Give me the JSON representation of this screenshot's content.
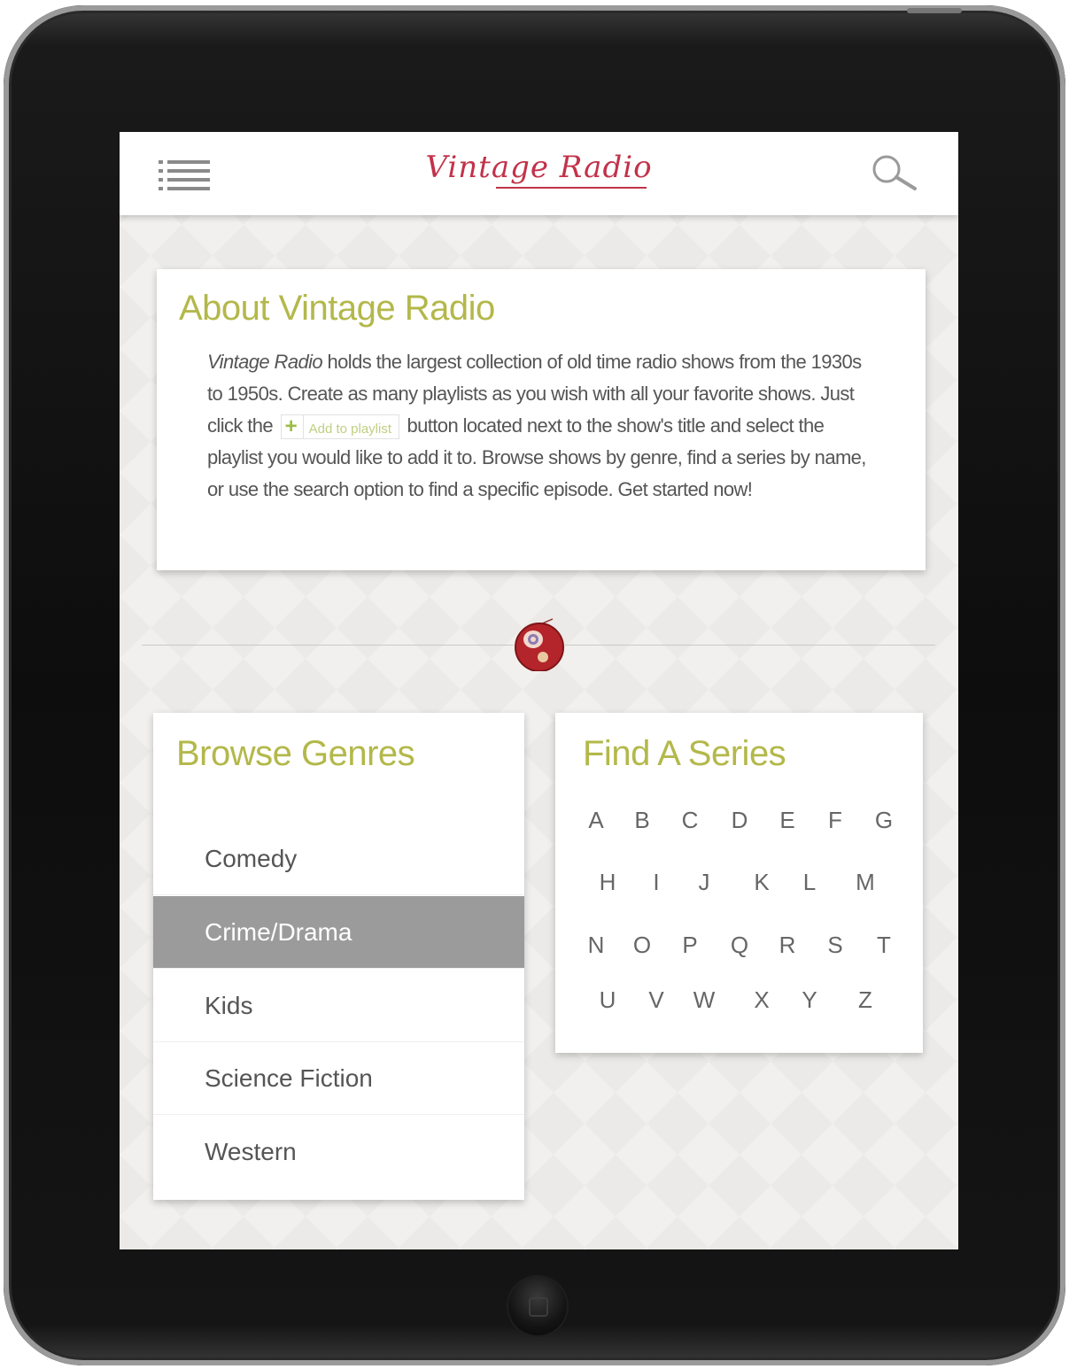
{
  "header": {
    "logo_text": "Vintage Radio",
    "menu_icon": "hamburger-menu-icon",
    "search_icon": "search-icon"
  },
  "about": {
    "title": "About Vintage Radio",
    "brand_italic": "Vintage Radio",
    "text_before_button": " holds the largest collection of old time radio shows from the 1930s to 1950s.  Create as many playlists as you wish with all your favorite shows.  Just click the ",
    "add_button_label": "Add to playlist",
    "text_after_button": " button located next to the show's title and select the playlist you would like to add it to.  Browse shows by genre, find a series by name, or use the search option to find a specific episode.  Get started now!"
  },
  "genres": {
    "title": "Browse Genres",
    "items": [
      "Comedy",
      "Crime/Drama",
      "Kids",
      "Science Fiction",
      "Western"
    ],
    "selected": "Crime/Drama"
  },
  "series": {
    "title": "Find A Series",
    "letters": [
      "A",
      "B",
      "C",
      "D",
      "E",
      "F",
      "G",
      "H",
      "I",
      "J",
      "K",
      "L",
      "M",
      "N",
      "O",
      "P",
      "Q",
      "R",
      "S",
      "T",
      "U",
      "V",
      "W",
      "X",
      "Y",
      "Z"
    ]
  },
  "colors": {
    "accent_title": "#b3b84a",
    "logo": "#c2324a",
    "selected_row": "#9b9b9b"
  }
}
